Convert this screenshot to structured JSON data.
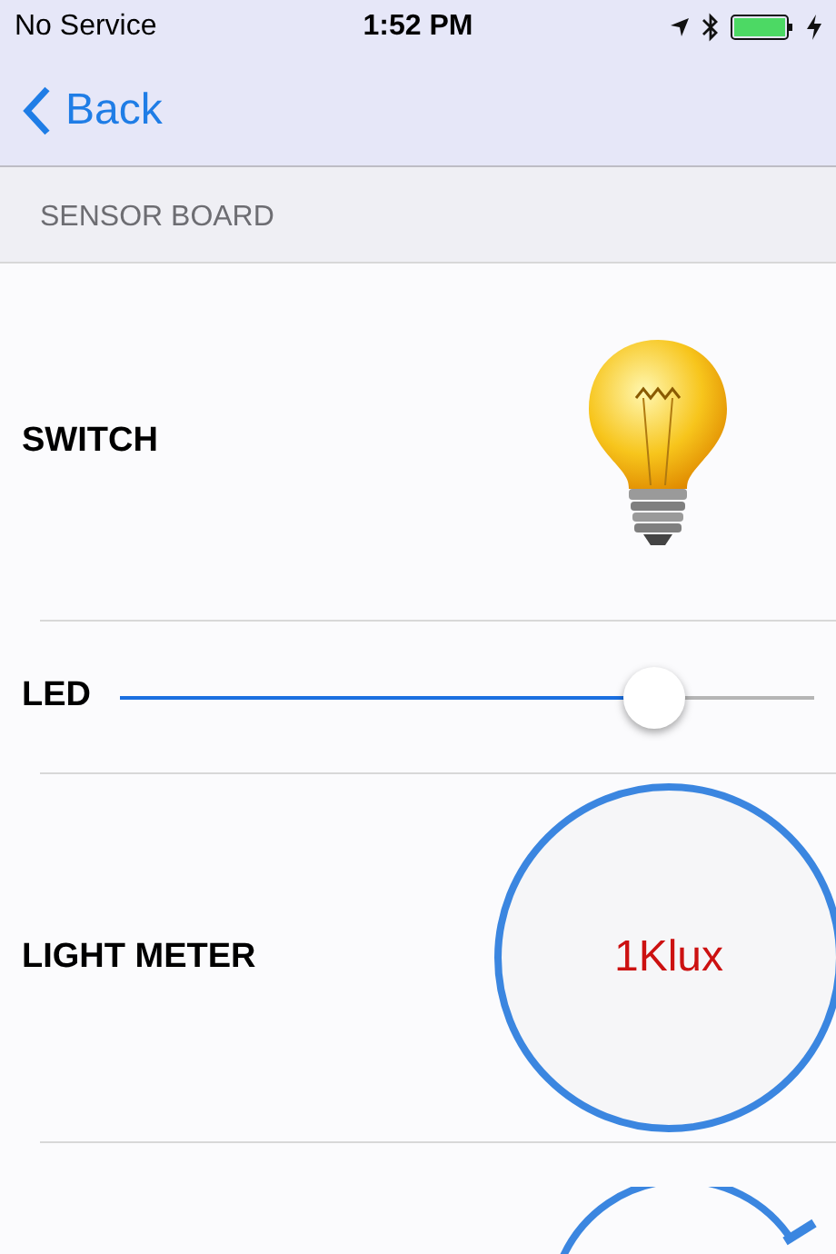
{
  "status_bar": {
    "carrier": "No Service",
    "time": "1:52 PM",
    "charging": true
  },
  "nav": {
    "back": "Back"
  },
  "section": {
    "title": "SENSOR BOARD"
  },
  "rows": [
    {
      "kind": "switch",
      "label": "SWITCH",
      "on": true
    },
    {
      "kind": "slider",
      "label": "LED",
      "level": 0.77
    },
    {
      "kind": "meter",
      "label": "LIGHT METER",
      "reading": "1Klux"
    },
    {
      "kind": "dial"
    }
  ]
}
